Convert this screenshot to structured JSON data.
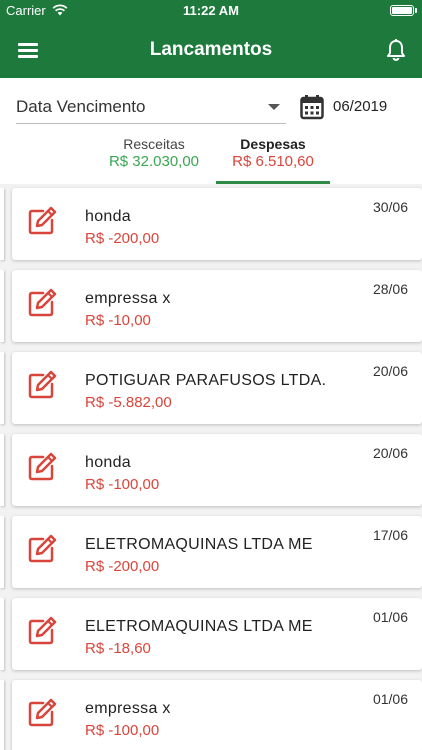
{
  "status_bar": {
    "carrier": "Carrier",
    "time": "11:22 AM"
  },
  "app_bar": {
    "title": "Lancamentos",
    "menu_icon": "menu-icon",
    "bell_icon": "bell-icon"
  },
  "filter": {
    "sort_field": "Data Vencimento",
    "period": "06/2019"
  },
  "tabs": [
    {
      "label": "Resceitas",
      "amount": "R$ 32.030,00",
      "active": false
    },
    {
      "label": "Despesas",
      "amount": "R$ 6.510,60",
      "active": true
    }
  ],
  "entries": [
    {
      "name": "honda",
      "value": "R$ -200,00",
      "date": "30/06"
    },
    {
      "name": "empressa x",
      "value": "R$ -10,00",
      "date": "28/06"
    },
    {
      "name": "POTIGUAR PARAFUSOS LTDA.",
      "value": "R$ -5.882,00",
      "date": "20/06"
    },
    {
      "name": "honda",
      "value": "R$ -100,00",
      "date": "20/06"
    },
    {
      "name": "ELETROMAQUINAS LTDA ME",
      "value": "R$ -200,00",
      "date": "17/06"
    },
    {
      "name": "ELETROMAQUINAS LTDA ME",
      "value": "R$ -18,60",
      "date": "01/06"
    },
    {
      "name": "empressa x",
      "value": "R$ -100,00",
      "date": "01/06"
    }
  ],
  "colors": {
    "primary": "#1e7a3c",
    "income": "#3aa651",
    "expense": "#d9453b"
  }
}
